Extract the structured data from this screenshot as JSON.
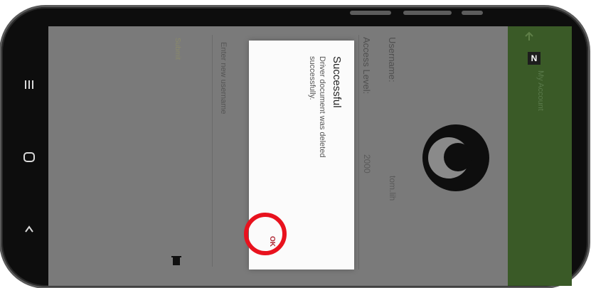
{
  "app": {
    "bar_color": "#3a5a27",
    "icon_letter": "N",
    "title": "My Account"
  },
  "profile": {
    "username_label": "Username:",
    "username_value": "tom.lih",
    "access_level_label": "Access Level:",
    "access_level_value": "2000",
    "new_username_placeholder": "Enter new username",
    "submit_label": "Submit"
  },
  "dialog": {
    "title": "Successful",
    "message": "Driver document was deleted successfully.",
    "ok_label": "OK"
  },
  "icons": {
    "nav_recents": "recents-icon",
    "nav_home": "home-icon",
    "nav_back": "back-icon",
    "app_logo": "app-logo-icon",
    "delete": "trash-icon",
    "avatar": "avatar-icon"
  },
  "colors": {
    "highlight": "#e8121e",
    "ok_text": "#b02a36"
  }
}
